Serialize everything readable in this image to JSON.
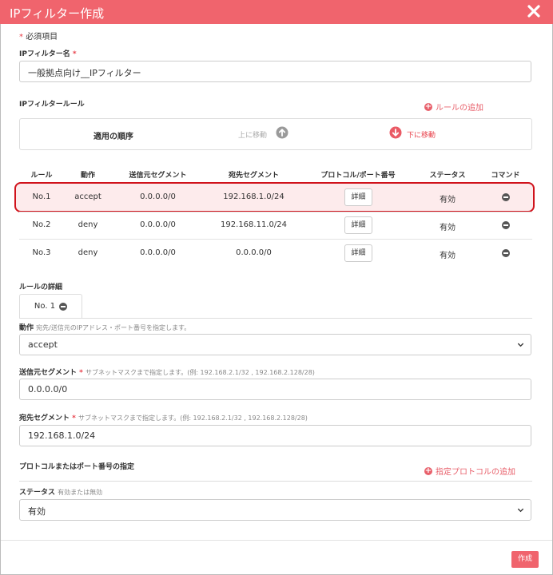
{
  "dialog": {
    "title": "IPフィルター作成"
  },
  "form": {
    "required_note": "必須項目",
    "name_label": "IPフィルター名",
    "name_value": "一般拠点向け__IPフィルター",
    "rule_section_label": "IPフィルタールール",
    "add_rule_label": "ルールの追加",
    "order_label": "適用の順序",
    "move_up_label": "上に移動",
    "move_down_label": "下に移動"
  },
  "table": {
    "headers": [
      "ルール",
      "動作",
      "送信元セグメント",
      "宛先セグメント",
      "プロトコル/ポート番号",
      "ステータス",
      "コマンド"
    ],
    "rows": [
      {
        "rule": "No.1",
        "action": "accept",
        "src": "0.0.0.0/0",
        "dst": "192.168.1.0/24",
        "detail": "詳細",
        "status": "有効"
      },
      {
        "rule": "No.2",
        "action": "deny",
        "src": "0.0.0.0/0",
        "dst": "192.168.11.0/24",
        "detail": "詳細",
        "status": "有効"
      },
      {
        "rule": "No.3",
        "action": "deny",
        "src": "0.0.0.0/0",
        "dst": "0.0.0.0/0",
        "detail": "詳細",
        "status": "有効"
      }
    ]
  },
  "details": {
    "section_label": "ルールの詳細",
    "tab_label": "No. 1",
    "action_label": "動作",
    "action_hint": "宛先/送信元のIPアドレス・ポート番号を指定します。",
    "action_value": "accept",
    "src_label": "送信元セグメント",
    "src_hint": "サブネットマスクまで指定します。(例: 192.168.2.1/32 , 192.168.2.128/28)",
    "src_value": "0.0.0.0/0",
    "dst_label": "宛先セグメント",
    "dst_hint": "サブネットマスクまで指定します。(例: 192.168.2.1/32 , 192.168.2.128/28)",
    "dst_value": "192.168.1.0/24",
    "protocol_label": "プロトコルまたはポート番号の指定",
    "add_protocol_label": "指定プロトコルの追加",
    "status_label": "ステータス",
    "status_hint": "有効または無効",
    "status_value": "有効"
  },
  "footer": {
    "submit_label": "作成"
  },
  "colors": {
    "accent": "#f0646d",
    "highlight_border": "#d0121b"
  }
}
